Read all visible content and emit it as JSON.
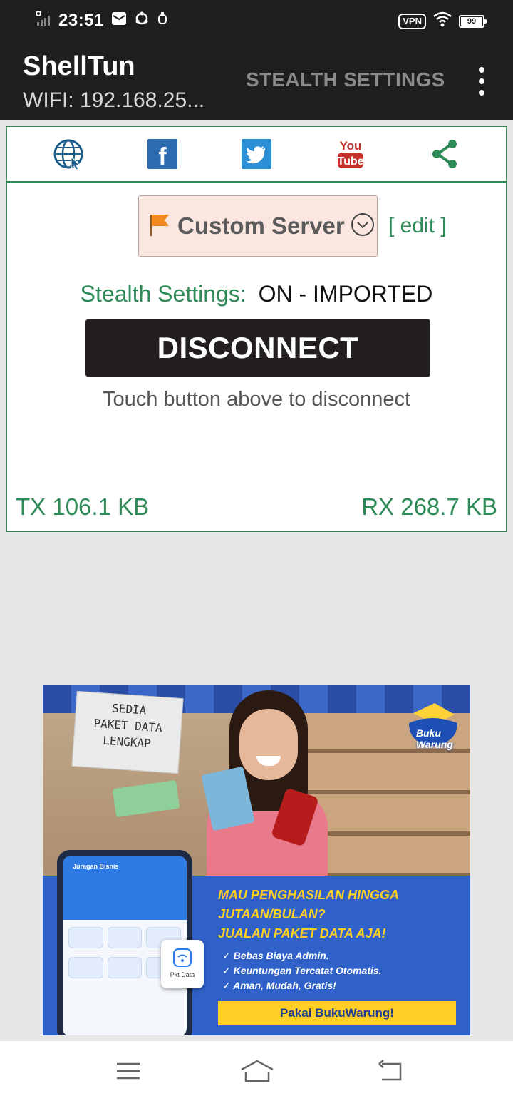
{
  "status_bar": {
    "time": "23:51",
    "vpn": "VPN",
    "battery": "99"
  },
  "app_bar": {
    "title": "ShellTun",
    "subtitle": "WIFI: 192.168.25...",
    "stealth_button": "STEALTH SETTINGS"
  },
  "social": {
    "icons": [
      "globe-icon",
      "facebook-icon",
      "twitter-icon",
      "youtube-icon",
      "share-icon"
    ],
    "youtube_top": "You",
    "youtube_bottom": "Tube",
    "facebook_letter": "f"
  },
  "main": {
    "server_label": "Custom Server",
    "edit_link": "[ edit ]",
    "stealth_label": "Stealth Settings:",
    "stealth_value": "ON - IMPORTED",
    "disconnect_button": "DISCONNECT",
    "hint": "Touch button above to disconnect",
    "tx": "TX 106.1 KB",
    "rx": "RX 268.7 KB"
  },
  "ad": {
    "sign_lines": [
      "SEDIA",
      "PAKET DATA",
      "LENGKAP"
    ],
    "logo_text": "Buku Warung",
    "phone_title": "Juragan Bisnis",
    "pkt_label": "Pkt Data",
    "headline_lines": [
      "MAU PENGHASILAN HINGGA",
      "JUTAAN/BULAN?",
      "JUALAN PAKET DATA AJA!"
    ],
    "checks": [
      "Bebas Biaya Admin.",
      "Keuntungan Tercatat Otomatis.",
      "Aman, Mudah, Gratis!"
    ],
    "cta": "Pakai BukuWarung!"
  },
  "colors": {
    "accent_green": "#2e8b57",
    "bar_dark": "#201e1f",
    "server_bg": "#fbe7df"
  }
}
